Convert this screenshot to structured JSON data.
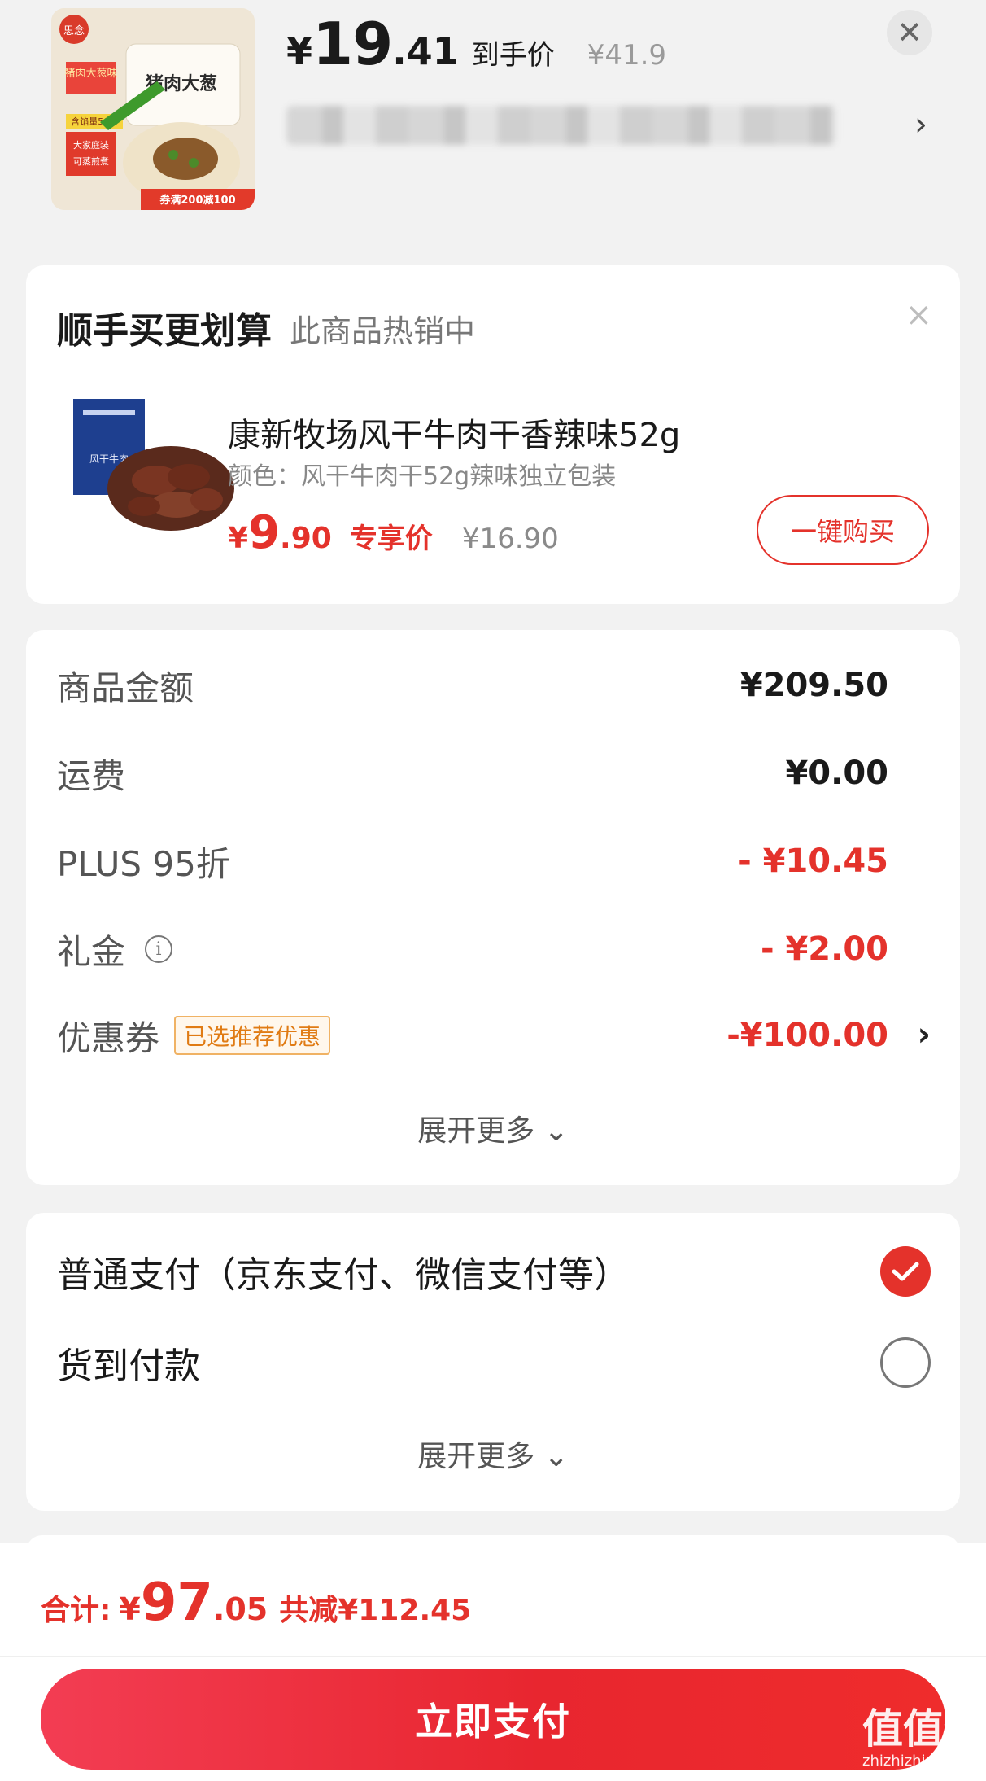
{
  "top_product": {
    "currency": "¥",
    "price_int": "19",
    "price_dec": ".41",
    "price_tag": "到手价",
    "original_price": "¥41.9",
    "close_icon": "close-icon",
    "address_chevron": "›"
  },
  "thumbnail_texts": {
    "brand": "思念",
    "flavor": "猪肉大葱味",
    "product": "猪肉大葱",
    "content": "含馅量50%",
    "line1": "大家庭装",
    "line2": "可蒸煎煮",
    "promo": "券满200减100"
  },
  "recommend": {
    "title": "顺手买更划算",
    "subtitle": "此商品热销中",
    "close": "×",
    "item": {
      "name": "康新牧场风干牛肉干香辣味52g",
      "variant": "颜色：风干牛肉干52g辣味独立包装",
      "currency": "¥",
      "price_int": "9",
      "price_dec": ".90",
      "exclusive": "专享价",
      "original_price": "¥16.90",
      "buy_label": "一键购买"
    },
    "pack_text": "风干牛肉"
  },
  "summary": {
    "rows": [
      {
        "label": "商品金额",
        "value": "¥209.50"
      },
      {
        "label": "运费",
        "value": "¥0.00"
      },
      {
        "label": "PLUS 95折",
        "value": "- ¥10.45"
      },
      {
        "label": "礼金",
        "value": "- ¥2.00"
      },
      {
        "label": "优惠券",
        "tag": "已选推荐优惠",
        "value": "-¥100.00"
      }
    ],
    "info_icon": "i",
    "chevron": "›",
    "expand": "展开更多 ⌄"
  },
  "payment": {
    "options": [
      {
        "label": "普通支付（京东支付、微信支付等）",
        "selected": true
      },
      {
        "label": "货到付款",
        "selected": false
      }
    ],
    "expand": "展开更多 ⌄"
  },
  "footer": {
    "total_label": "合计:",
    "currency": "¥",
    "total_int": "97",
    "total_dec": ".05",
    "reduce": "共减¥112.45",
    "pay_button": "立即支付"
  },
  "watermark": {
    "big": "值值值",
    "small": "zhizhizhi.com"
  },
  "colors": {
    "accent": "#e4322b",
    "coupon_tag": "#e07b14"
  }
}
